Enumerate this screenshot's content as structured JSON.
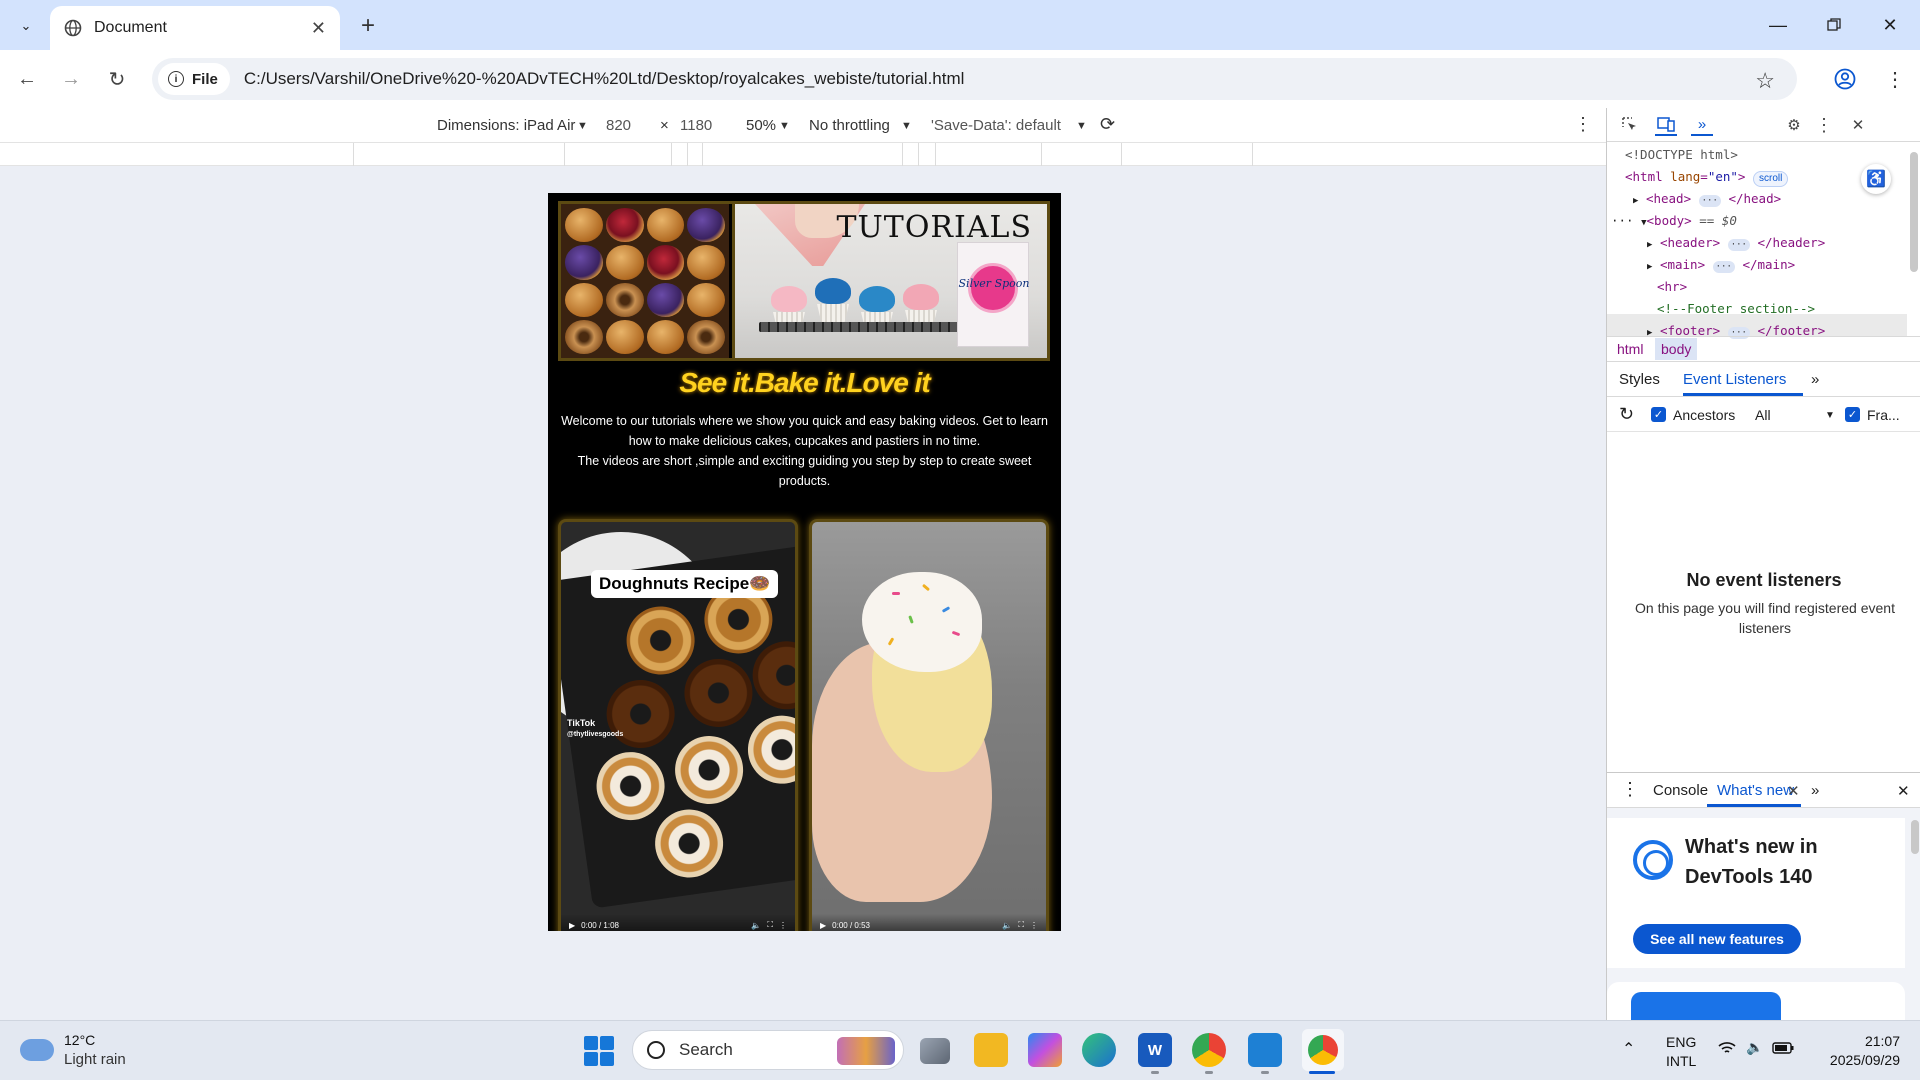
{
  "browser": {
    "tab_title": "Document",
    "address_chip": "File",
    "url": "C:/Users/Varshil/OneDrive%20-%20ADvTECH%20Ltd/Desktop/royalcakes_webiste/tutorial.html"
  },
  "device_toolbar": {
    "dimensions_label": "Dimensions: iPad Air",
    "width": "820",
    "times": "×",
    "height": "1180",
    "zoom": "50%",
    "throttling": "No throttling",
    "save_data": "'Save-Data': default"
  },
  "page": {
    "banner_title": "TUTORIALS",
    "sugar_brand": "Silver Spoon",
    "tagline": "See it.Bake it.Love it",
    "intro_line1": "Welcome to our tutorials where we show you quick and easy baking videos. Get to learn how to make delicious cakes, cupcakes and pastiers in no time.",
    "intro_line2": "The videos are short ,simple and exciting guiding you step by step to create sweet products.",
    "video1": {
      "overlay": "Doughnuts Recipe🍩",
      "watermark": "TikTok",
      "handle": "@thytlivesgoods",
      "time": "0:00 / 1:08"
    },
    "video2": {
      "time": "0:00 / 0:53"
    }
  },
  "devtools": {
    "elements": {
      "doctype": "<!DOCTYPE html>",
      "html_open": "<html",
      "lang_attr": "lang",
      "lang_val": "\"en\"",
      "scroll_badge": "scroll",
      "head": "<head>",
      "head_close": "</head>",
      "body": "<body>",
      "body_marker": "== $0",
      "header": "<header>",
      "header_close": "</header>",
      "main": "<main>",
      "main_close": "</main>",
      "hr": "<hr>",
      "comment": "<!--Footer section-->",
      "footer": "<footer>",
      "footer_close": "</footer>",
      "ellipsis": "···",
      "row_dots": "···"
    },
    "breadcrumbs": [
      "html",
      "body"
    ],
    "subtabs": {
      "styles": "Styles",
      "event_listeners": "Event Listeners"
    },
    "listeners_bar": {
      "ancestors": "Ancestors",
      "filter": "All",
      "framework": "Fra..."
    },
    "empty_title": "No event listeners",
    "empty_desc": "On this page you will find registered event listeners",
    "drawer": {
      "console": "Console",
      "whats_new": "What's new"
    },
    "whats_new_title": "What's new in DevTools 140",
    "whats_new_button": "See all new features"
  },
  "taskbar": {
    "temperature": "12°C",
    "weather": "Light rain",
    "search_placeholder": "Search",
    "lang1": "ENG",
    "lang2": "INTL",
    "time": "21:07",
    "date": "2025/09/29",
    "word_letter": "W"
  },
  "colors": {
    "tabstrip": "#d3e3fd",
    "accent": "#0b57d0",
    "tagline": "#ffd21f"
  }
}
